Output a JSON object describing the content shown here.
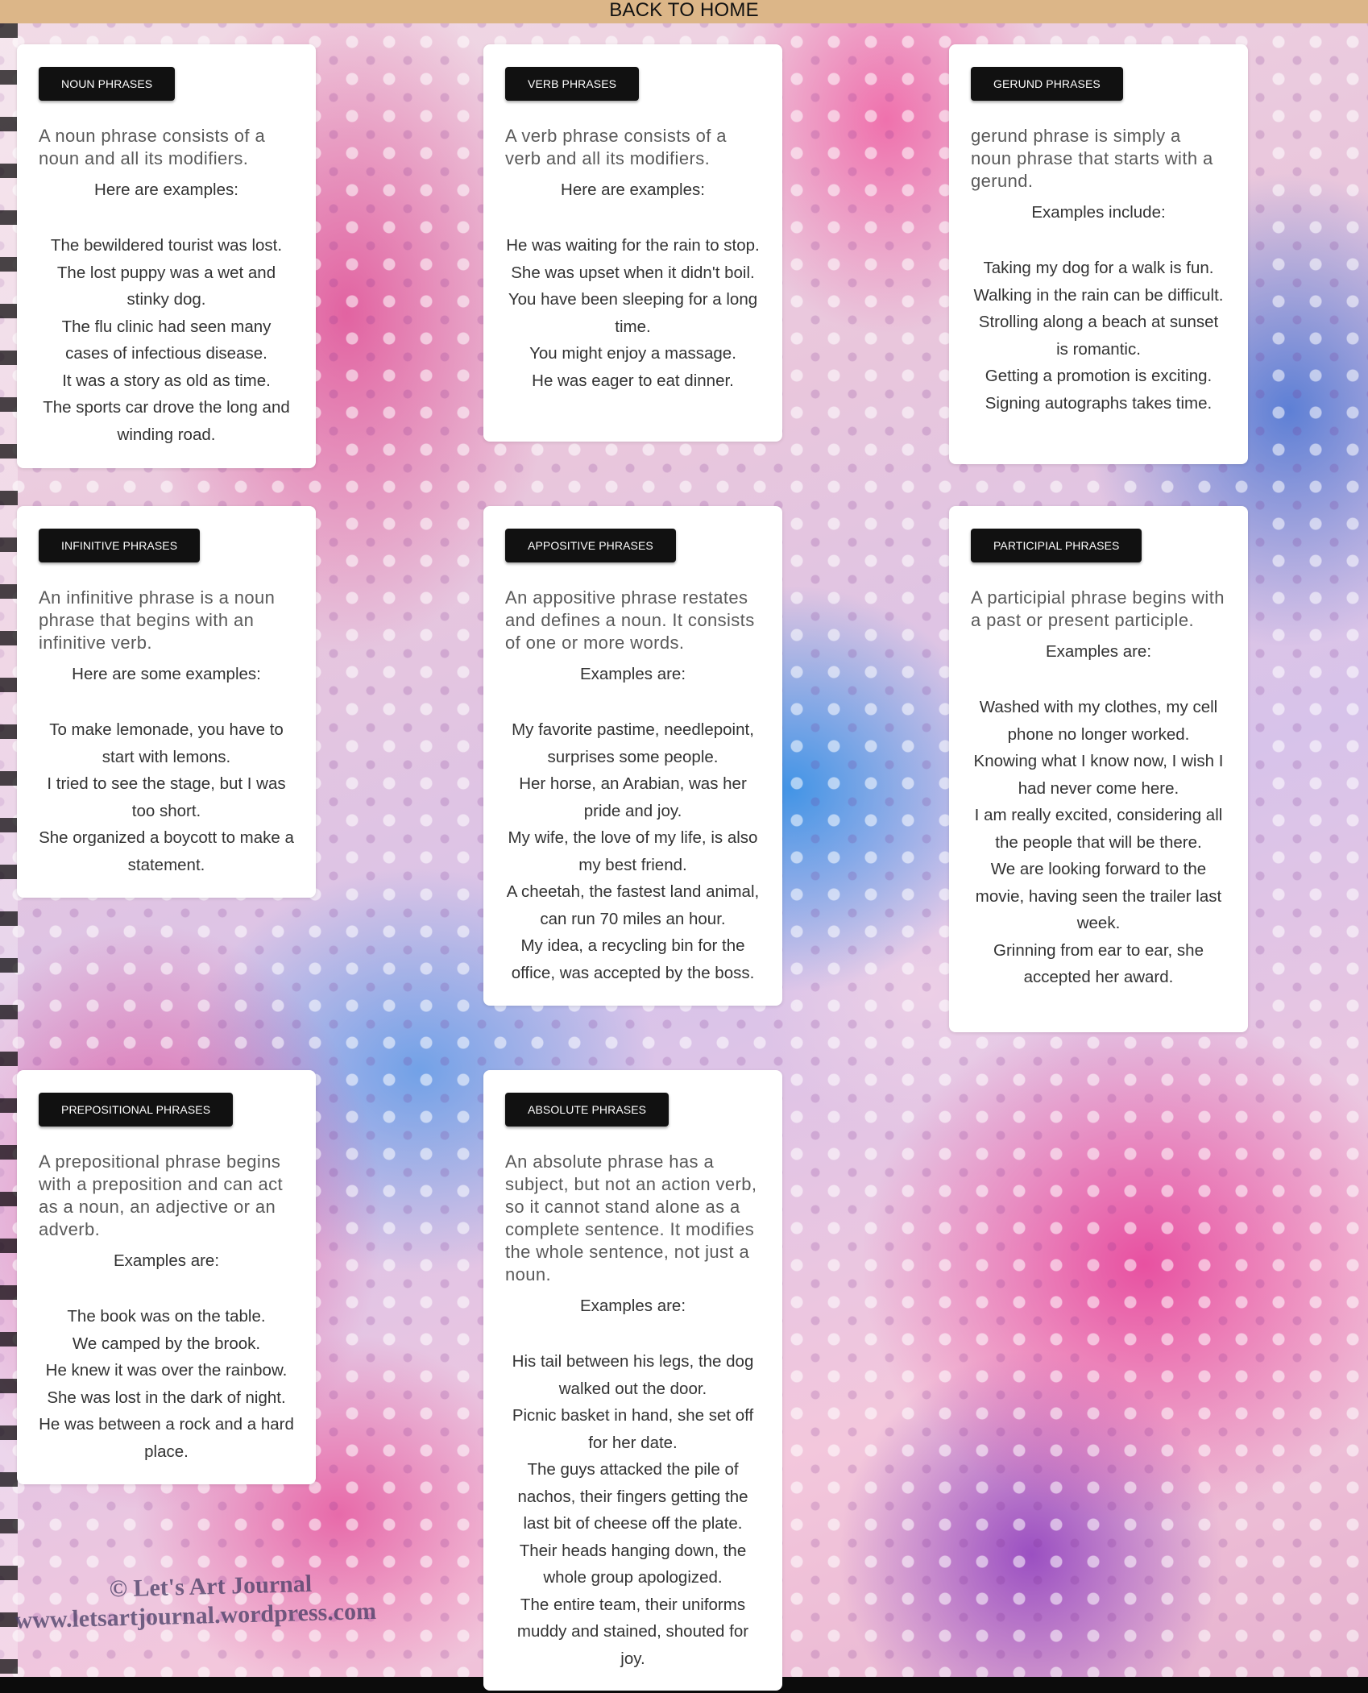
{
  "nav": {
    "back_label": "BACK TO HOME"
  },
  "background": {
    "credit_line1": "© Let's Art Journal",
    "credit_line2": "www.letsartjournal.wordpress.com"
  },
  "cards": [
    {
      "tag": "NOUN PHRASES",
      "intro": "A noun phrase consists of a noun and all its modifiers.",
      "lead": "Here are examples:",
      "examples": [
        "The bewildered tourist was lost.",
        "The lost puppy was a wet and stinky dog.",
        "The flu clinic had seen many cases of infectious disease.",
        "It was a story as old as time.",
        "The sports car drove the long and winding road."
      ]
    },
    {
      "tag": "VERB PHRASES",
      "intro": "A verb phrase consists of a verb and all its modifiers.",
      "lead": "Here are examples:",
      "examples": [
        "He was waiting for the rain to stop.",
        "She was upset when it didn't boil.",
        "You have been sleeping for a long time.",
        "You might enjoy a massage.",
        "He was eager to eat dinner."
      ]
    },
    {
      "tag": "GERUND PHRASES",
      "intro": "gerund phrase is simply a noun phrase that starts with a gerund.",
      "lead": "Examples include:",
      "examples": [
        "Taking my dog for a walk is fun.",
        "Walking in the rain can be difficult.",
        "Strolling along a beach at sunset is romantic.",
        "Getting a promotion is exciting.",
        "Signing autographs takes time."
      ]
    },
    {
      "tag": "INFINITIVE PHRASES",
      "intro": "An infinitive phrase is a noun phrase that begins with an infinitive verb.",
      "lead": "Here are some examples:",
      "examples": [
        "To make lemonade, you have to start with lemons.",
        "I tried to see the stage, but I was too short.",
        "She organized a boycott to make a statement."
      ]
    },
    {
      "tag": "APPOSITIVE PHRASES",
      "intro": "An appositive phrase restates and defines a noun. It consists of one or more words.",
      "lead": "Examples are:",
      "examples": [
        "My favorite pastime, needlepoint, surprises some people.",
        "Her horse, an Arabian, was her pride and joy.",
        "My wife, the love of my life, is also my best friend.",
        "A cheetah, the fastest land animal, can run 70 miles an hour.",
        "My idea, a recycling bin for the office, was accepted by the boss."
      ]
    },
    {
      "tag": "PARTICIPIAL PHRASES",
      "intro": "A participial phrase begins with a past or present participle.",
      "lead": "Examples are:",
      "examples": [
        "Washed with my clothes, my cell phone no longer worked.",
        "Knowing what I know now, I wish I had never come here.",
        "I am really excited, considering all the people that will be there.",
        "We are looking forward to the movie, having seen the trailer last week.",
        "Grinning from ear to ear, she accepted her award."
      ]
    },
    {
      "tag": "PREPOSITIONAL PHRASES",
      "intro": "A prepositional phrase begins with a preposition and can act as a noun, an adjective or an adverb.",
      "lead": "Examples are:",
      "examples": [
        "The book was on the table.",
        "We camped by the brook.",
        "He knew it was over the rainbow.",
        "She was lost in the dark of night.",
        "He was between a rock and a hard place."
      ]
    },
    {
      "tag": "ABSOLUTE PHRASES",
      "intro": "An absolute phrase has a subject, but not an action verb, so it cannot stand alone as a complete sentence. It modifies the whole sentence, not just a noun.",
      "lead": "Examples are:",
      "examples": [
        "His tail between his legs, the dog walked out the door.",
        "Picnic basket in hand, she set off for her date.",
        "The guys attacked the pile of nachos, their fingers getting the last bit of cheese off the plate.",
        "Their heads hanging down, the whole group apologized.",
        "The entire team, their uniforms muddy and stained, shouted for joy."
      ]
    }
  ]
}
